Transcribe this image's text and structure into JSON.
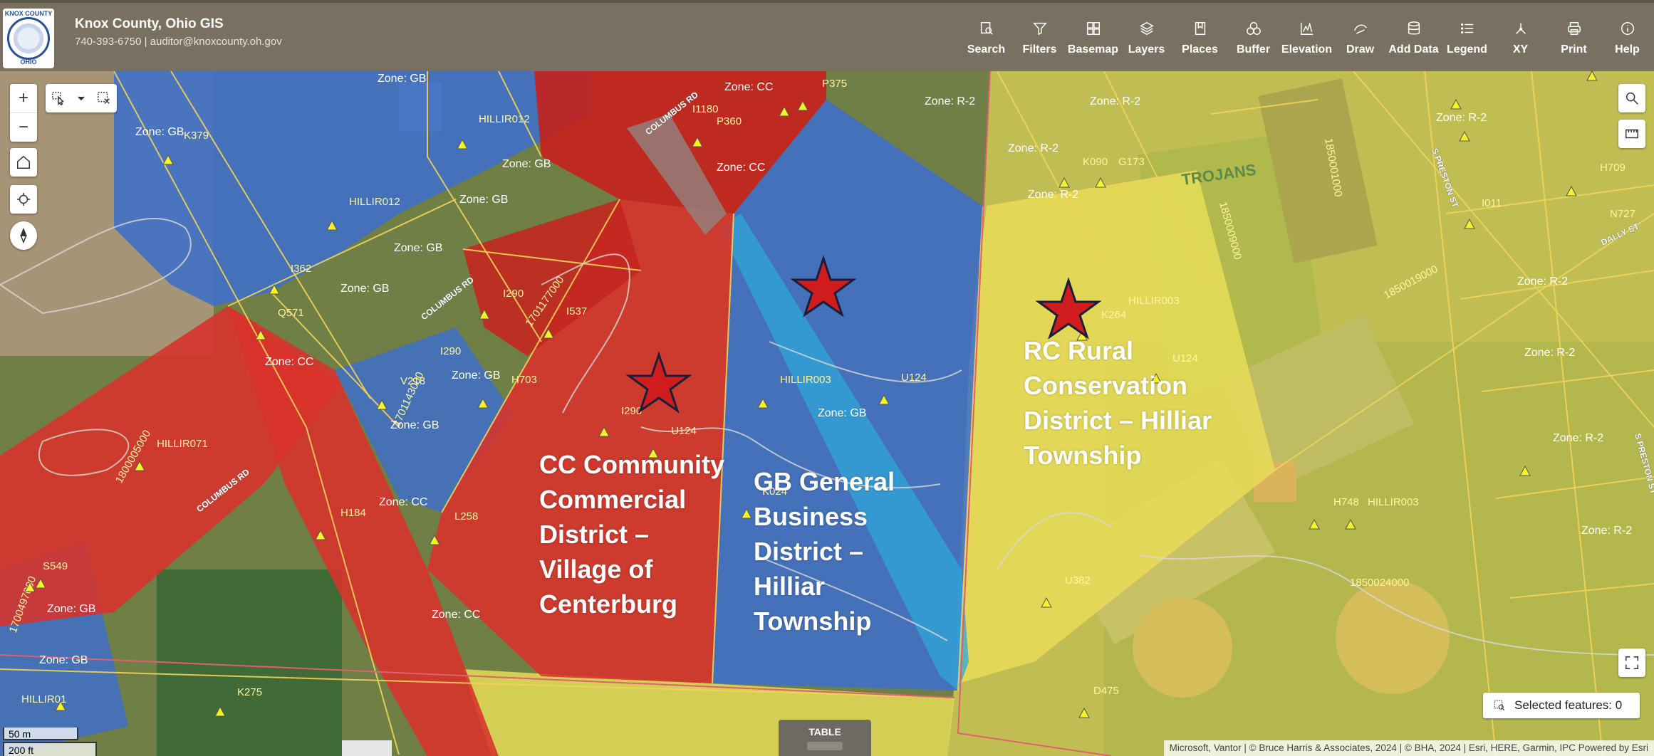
{
  "header": {
    "title": "Knox County, Ohio GIS",
    "contact": "740-393-6750 | auditor@knoxcounty.oh.gov",
    "logo_text_top": "KNOX COUNTY",
    "logo_text_bottom": "OHIO"
  },
  "toolbar": [
    {
      "id": "search",
      "label": "Search",
      "icon": "search-doc-icon"
    },
    {
      "id": "filters",
      "label": "Filters",
      "icon": "funnel-icon"
    },
    {
      "id": "basemap",
      "label": "Basemap",
      "icon": "grid-icon"
    },
    {
      "id": "layers",
      "label": "Layers",
      "icon": "layers-icon"
    },
    {
      "id": "places",
      "label": "Places",
      "icon": "bookmark-icon"
    },
    {
      "id": "buffer",
      "label": "Buffer",
      "icon": "buffer-icon"
    },
    {
      "id": "elevation",
      "label": "Elevation",
      "icon": "elevation-icon"
    },
    {
      "id": "draw",
      "label": "Draw",
      "icon": "draw-icon"
    },
    {
      "id": "add-data",
      "label": "Add Data",
      "icon": "database-icon"
    },
    {
      "id": "legend",
      "label": "Legend",
      "icon": "list-icon"
    },
    {
      "id": "xy",
      "label": "XY",
      "icon": "xy-icon"
    },
    {
      "id": "print",
      "label": "Print",
      "icon": "printer-icon"
    },
    {
      "id": "help",
      "label": "Help",
      "icon": "info-icon"
    }
  ],
  "map_controls": {
    "zoom_in": "+",
    "zoom_out": "−"
  },
  "zone_annotations": {
    "cc": "CC Community Commercial District – Village of Centerburg",
    "gb": "GB General Business District – Hilliar Township",
    "rc": "RC Rural Conservation District – Hilliar Township"
  },
  "map_labels": {
    "parcels": [
      "K379",
      "HILLIR012",
      "HILLIR012",
      "I362",
      "Q571",
      "I290",
      "1701177000",
      "I537",
      "H703",
      "I290",
      "V218",
      "HILLIR071",
      "1800005000",
      "I290",
      "U124",
      "H184",
      "L258",
      "S549",
      "1700497000",
      "HILLIR01",
      "K275",
      "HILLIR003",
      "U124",
      "K024",
      "I1180",
      "P360",
      "P375",
      "K090",
      "G173",
      "HILLIR003",
      "K264",
      "U124",
      "H748",
      "HILLIR003",
      "1850024000",
      "U382",
      "D475",
      "1850019000",
      "1850001000",
      "1850009000",
      "I011",
      "N727",
      "H709",
      "1701143000"
    ],
    "zones": [
      "Zone: GB",
      "Zone: CC",
      "Zone: R-2"
    ],
    "roads": [
      "COLUMBUS RD",
      "COLUMBUS RD",
      "COLUMBUS RD",
      "S PRESTON ST",
      "DALLY ST",
      "S PRESTON ST"
    ],
    "field_text": "TROJANS"
  },
  "selected_features": {
    "label": "Selected features: 0"
  },
  "table_tab": {
    "label": "TABLE"
  },
  "attribution": "Microsoft, Vantor | © Bruce Harris & Associates, 2024 | © BHA, 2024 | Esri, HERE, Garmin, IPC    Powered by Esri",
  "scale": {
    "metric": "50 m",
    "imperial": "200 ft"
  },
  "colors": {
    "header_bg": "#7a7061",
    "zone_cc": "#d9322b",
    "zone_gb": "#3f6fc9",
    "zone_rc": "#e8dc58",
    "parcel_line": "#f1d35a",
    "star": "#d01c1c"
  }
}
